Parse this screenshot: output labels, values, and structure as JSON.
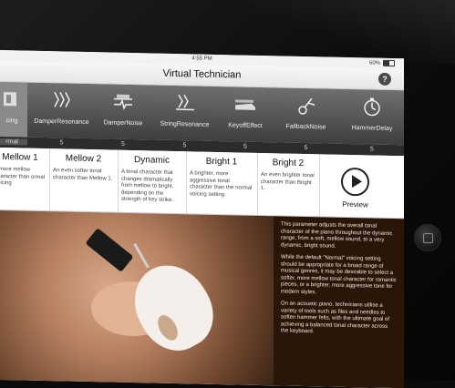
{
  "status": {
    "time": "4:55 PM",
    "battery": "60%"
  },
  "nav": {
    "title": "Virtual Technician",
    "help": "?"
  },
  "tools": [
    {
      "label": "cing",
      "value": "rmal",
      "icon": "voicing-icon"
    },
    {
      "label": "DamperResonance",
      "value": "5",
      "icon": "damper-resonance-icon"
    },
    {
      "label": "DamperNoise",
      "value": "5",
      "icon": "damper-noise-icon"
    },
    {
      "label": "StringResonance",
      "value": "5",
      "icon": "string-resonance-icon"
    },
    {
      "label": "KeyoffEffect",
      "value": "5",
      "icon": "keyoff-effect-icon"
    },
    {
      "label": "FallbackNoise",
      "value": "5",
      "icon": "fallback-noise-icon"
    },
    {
      "label": "HammerDelay",
      "value": "5",
      "icon": "hammer-delay-icon"
    }
  ],
  "presets": [
    {
      "name": "Mellow 1",
      "desc": "r, more mellow character than ormal voicing"
    },
    {
      "name": "Mellow 2",
      "desc": "An even softer tonal character than Mellow 1."
    },
    {
      "name": "Dynamic",
      "desc": "A tonal character that changes dramatically from mellow to bright, depending on the strength of key strike."
    },
    {
      "name": "Bright 1",
      "desc": "A brighter, more aggressive tonal character than the normal voicing setting."
    },
    {
      "name": "Bright 2",
      "desc": "An even brighter tonal character than Bright 1."
    }
  ],
  "preview": {
    "label": "Preview"
  },
  "info": [
    "This parameter adjusts the overall tonal character of the piano throughout the dynamic range, from a soft, mellow sound, to a very dynamic, bright sound.",
    "While the default \"Normal\" voicing setting should be appropriate for a broad range of musical genres, it may be desirable to select a softer, more mellow tonal character for romantic pieces, or a brighter, more aggressive tone for modern styles.",
    "On an acoustic piano, technicians utilise a variety of tools such as files and needles to soften hammer felts, with the ultimate goal of achieving a balanced tonal character across the keyboard."
  ],
  "colors": {
    "info_bg": "#2a1608",
    "toolbar_bg": "#4e4e4e"
  }
}
